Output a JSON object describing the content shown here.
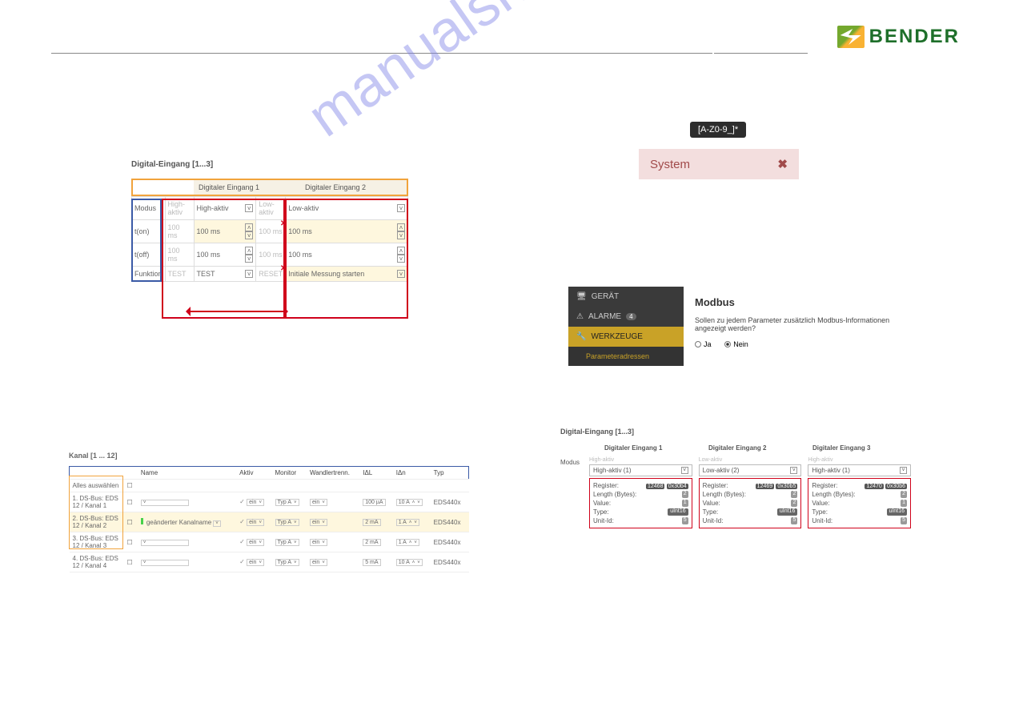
{
  "brand": "BENDER",
  "watermark": "manualshive.com",
  "figA": {
    "title": "Digital-Eingang [1...3]",
    "colA": "Digitaler Eingang 1",
    "colB": "Digitaler Eingang 2",
    "rows": {
      "modus": {
        "label": "Modus",
        "grayA": "High-aktiv",
        "valA": "High-aktiv",
        "grayB": "Low-aktiv",
        "valB": "Low-aktiv"
      },
      "ton": {
        "label": "t(on)",
        "grayA": "100 ms",
        "valA": "100 ms",
        "grayB": "100 ms",
        "valB": "100 ms"
      },
      "toff": {
        "label": "t(off)",
        "grayA": "100 ms",
        "valA": "100 ms",
        "grayB": "100 ms",
        "valB": "100 ms"
      },
      "funk": {
        "label": "Funktion",
        "grayA": "TEST",
        "valA": "TEST",
        "grayB": "RESET",
        "valB": "Initiale Messung starten"
      }
    }
  },
  "figB": {
    "tooltip": "[A-Z0-9_]*",
    "label": "System",
    "x": "✖"
  },
  "figC": {
    "menu": {
      "device": "GERÄT",
      "alarms": "ALARME",
      "alarm_count": "4",
      "tools": "WERKZEUGE",
      "sub": "Parameteradressen"
    },
    "title": "Modbus",
    "question": "Sollen zu jedem Parameter zusätzlich Modbus-Informationen angezeigt werden?",
    "ja": "Ja",
    "nein": "Nein"
  },
  "figD": {
    "title": "Kanal [1 ... 12]",
    "columns": [
      "Name",
      "Aktiv",
      "Monitor",
      "Wandlertrenn.",
      "IΔL",
      "IΔn",
      "Typ"
    ],
    "selectAll": "Alles auswählen",
    "rows": [
      {
        "label": "1. DS-Bus: EDS 12 / Kanal 1",
        "name": "",
        "aktiv": "ein",
        "mon": "Typ A",
        "wt": "ein",
        "idl": "100 µA",
        "idn": "10 A",
        "typ": "EDS440x"
      },
      {
        "label": "2. DS-Bus: EDS 12 / Kanal 2",
        "name": "geänderter Kanalname",
        "aktiv": "ein",
        "mon": "Typ A",
        "wt": "ein",
        "idl": "2 mA",
        "idn": "1 A",
        "typ": "EDS440x",
        "hl": true,
        "green": true
      },
      {
        "label": "3. DS-Bus: EDS 12 / Kanal 3",
        "name": "",
        "aktiv": "ein",
        "mon": "Typ A",
        "wt": "ein",
        "idl": "2 mA",
        "idn": "1 A",
        "typ": "EDS440x"
      },
      {
        "label": "4. DS-Bus: EDS 12 / Kanal 4",
        "name": "",
        "aktiv": "ein",
        "mon": "Typ A",
        "wt": "ein",
        "idl": "5 mA",
        "idn": "10 A",
        "typ": "EDS440x"
      }
    ]
  },
  "figE": {
    "title": "Digital-Eingang [1...3]",
    "rowlabel": "Modus",
    "info_labels": {
      "reg": "Register:",
      "len": "Length (Bytes):",
      "val": "Value:",
      "typ": "Type:",
      "uid": "Unit-Id:"
    },
    "cols": [
      {
        "hdr": "Digitaler Eingang 1",
        "gray": "High-aktiv",
        "sel": "High-aktiv (1)",
        "reg": "12468 0x30b4",
        "len": "2",
        "val": "1",
        "typ": "uInt16",
        "uid": "5"
      },
      {
        "hdr": "Digitaler Eingang 2",
        "gray": "Low-aktiv",
        "sel": "Low-aktiv (2)",
        "reg": "12469 0x30b5",
        "len": "2",
        "val": "2",
        "typ": "uInt16",
        "uid": "5"
      },
      {
        "hdr": "Digitaler Eingang 3",
        "gray": "High-aktiv",
        "sel": "High-aktiv (1)",
        "reg": "12470 0x30b6",
        "len": "2",
        "val": "1",
        "typ": "uInt16",
        "uid": "5"
      }
    ]
  }
}
